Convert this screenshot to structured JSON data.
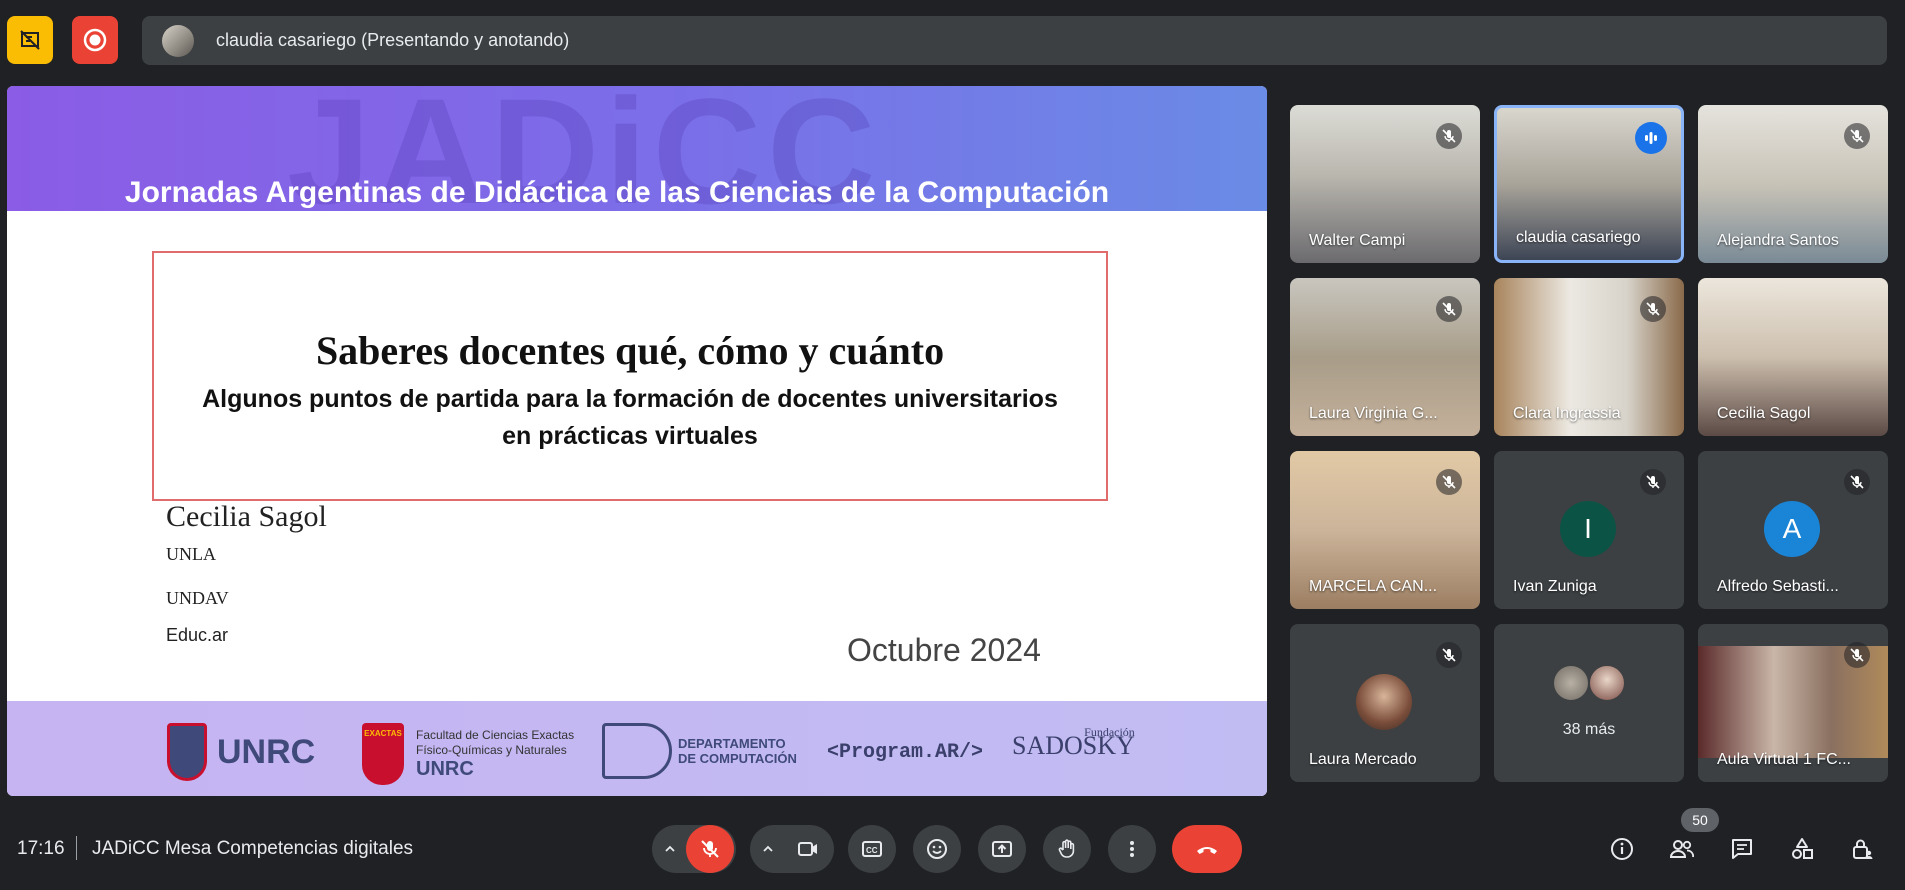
{
  "presenter_bar": {
    "text": "claudia casariego (Presentando y anotando)"
  },
  "slide": {
    "watermark": "JADiCC",
    "header_title": "Jornadas Argentinas de Didáctica de las Ciencias de la Computación",
    "main_title": "Saberes docentes qué, cómo y cuánto",
    "subtitle_line1": "Algunos puntos de partida para la  formación de docentes universitarios",
    "subtitle_line2": "en prácticas virtuales",
    "author": "Cecilia Sagol",
    "affiliation1": "UNLA",
    "affiliation2": "UNDAV",
    "affiliation3": "Educ.ar",
    "date": "Octubre 2024",
    "logos": {
      "unrc": "UNRC",
      "exactas_shield": "EXACTAS",
      "exactas_line1": "Facultad de Ciencias Exactas",
      "exactas_line2": "Físico-Químicas y Naturales",
      "exactas_line3": "UNRC",
      "depto_line1": "DEPARTAMENTO",
      "depto_line2": "DE COMPUTACIÓN",
      "program": "<Program.AR/>",
      "sadosky_small": "Fundación",
      "sadosky": "SADOSKY"
    }
  },
  "participants": [
    {
      "name": "Walter Campi"
    },
    {
      "name": "claudia casariego"
    },
    {
      "name": "Alejandra Santos"
    },
    {
      "name": "Laura Virginia G..."
    },
    {
      "name": "Clara Ingrassia"
    },
    {
      "name": "Cecilia Sagol"
    },
    {
      "name": "MARCELA CAN..."
    },
    {
      "name": "Ivan Zuniga",
      "initial": "I"
    },
    {
      "name": "Alfredo Sebasti...",
      "initial": "A"
    },
    {
      "name": "Laura Mercado"
    },
    {
      "name": "",
      "more": "38 más"
    },
    {
      "name": "Aula Virtual 1 FC..."
    }
  ],
  "bottom_bar": {
    "time": "17:16",
    "meeting_title": "JADiCC Mesa Competencias digitales",
    "people_count": "50"
  },
  "colors": {
    "background": "#202124",
    "tile": "#3c4043",
    "mute_red": "#ea4335",
    "annotation_yellow": "#fbbc04",
    "speaking_blue": "#1a73e8",
    "avatar_green": "#0b5345",
    "avatar_blue": "#1a85d6"
  }
}
